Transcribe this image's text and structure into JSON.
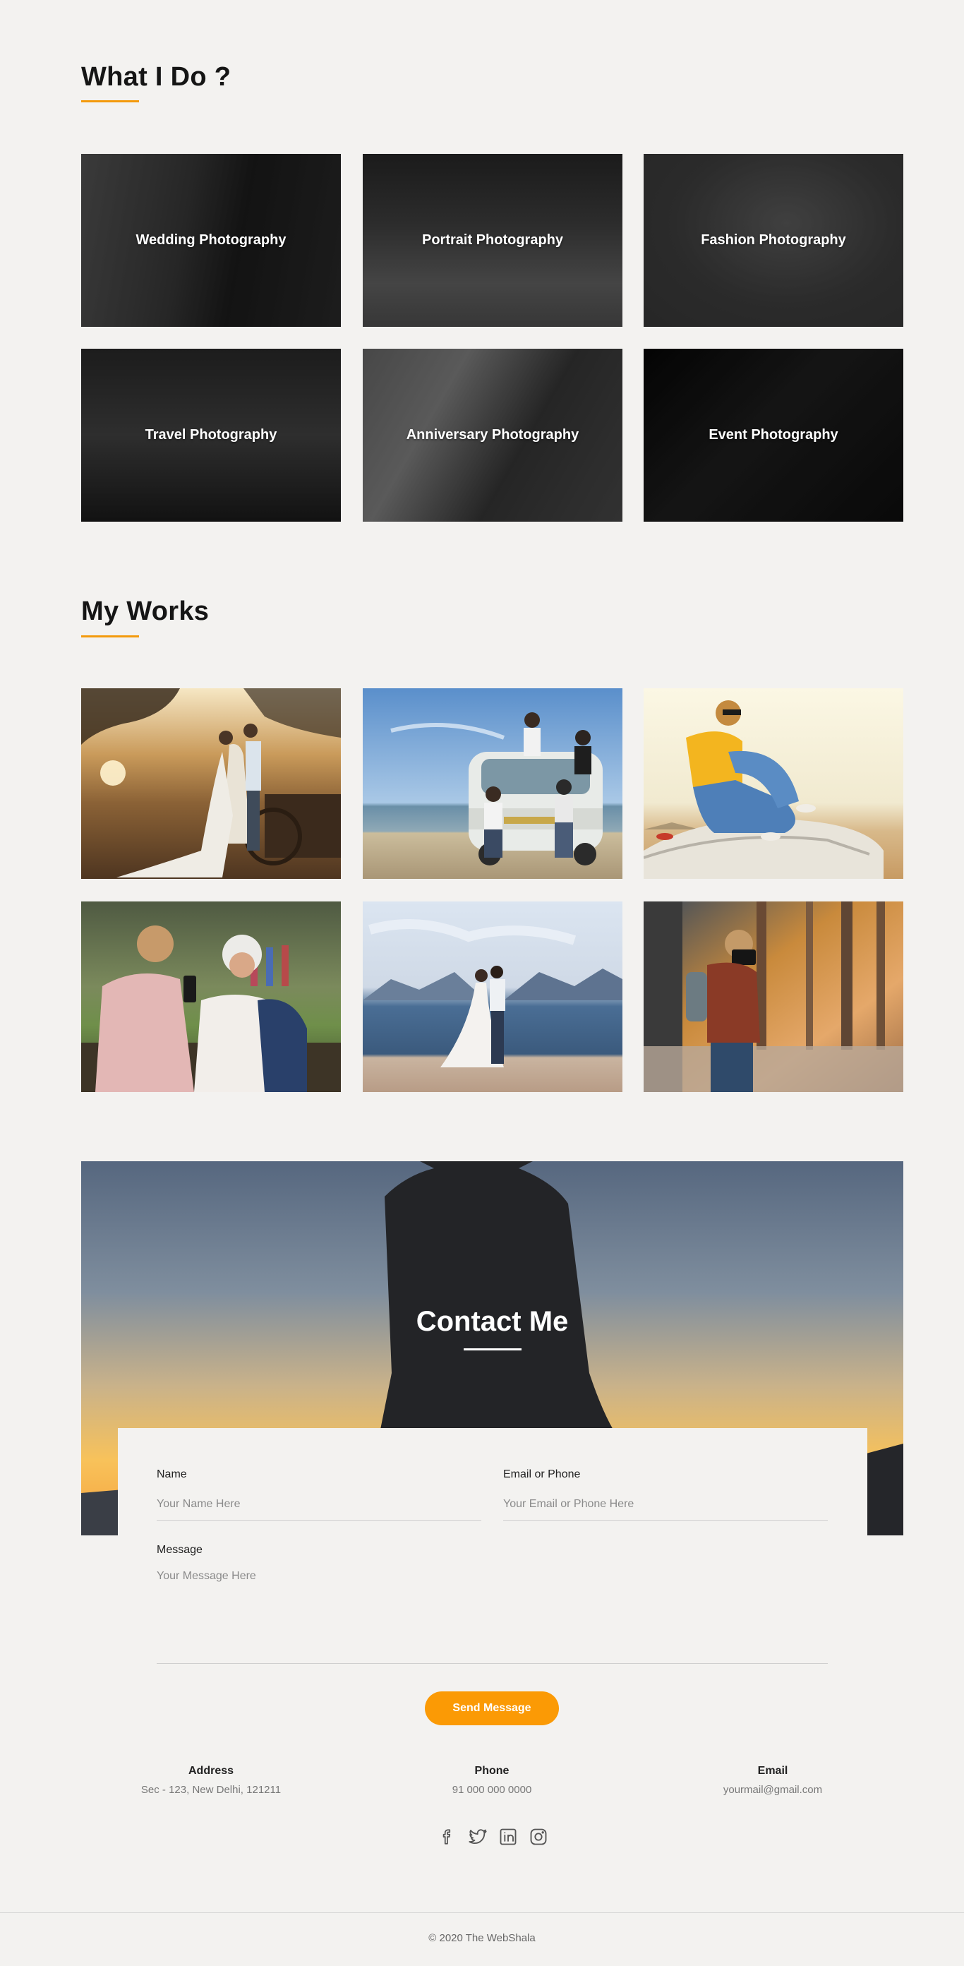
{
  "services": {
    "title": "What I Do ?",
    "items": [
      {
        "label": "Wedding Photography"
      },
      {
        "label": "Portrait Photography"
      },
      {
        "label": "Fashion Photography"
      },
      {
        "label": "Travel Photography"
      },
      {
        "label": "Anniversary Photography"
      },
      {
        "label": "Event Photography"
      }
    ]
  },
  "works": {
    "title": "My Works",
    "items": [
      {
        "subject": "couple-in-field-photo"
      },
      {
        "subject": "friends-with-van-photo"
      },
      {
        "subject": "woman-on-car-photo"
      },
      {
        "subject": "woman-and-grandmother-photo"
      },
      {
        "subject": "bride-and-groom-by-lake-photo"
      },
      {
        "subject": "woman-with-camera-in-forest-photo"
      }
    ]
  },
  "contact": {
    "title": "Contact Me",
    "form": {
      "name_label": "Name",
      "name_placeholder": "Your Name Here",
      "email_label": "Email or Phone",
      "email_placeholder": "Your Email or Phone Here",
      "message_label": "Message",
      "message_placeholder": "Your Message Here",
      "send_label": "Send Message"
    },
    "info": {
      "address_title": "Address",
      "address_value": "Sec - 123, New Delhi, 121211",
      "phone_title": "Phone",
      "phone_value": "91 000 000 0000",
      "email_title": "Email",
      "email_value": "yourmail@gmail.com"
    },
    "socials": [
      "facebook-icon",
      "twitter-icon",
      "linkedin-icon",
      "instagram-icon"
    ]
  },
  "footer": {
    "copyright": "© 2020 The WebShala"
  },
  "colors": {
    "background": "#f3f2f0",
    "accent": "#f39a0c",
    "button": "#fb9a05"
  }
}
